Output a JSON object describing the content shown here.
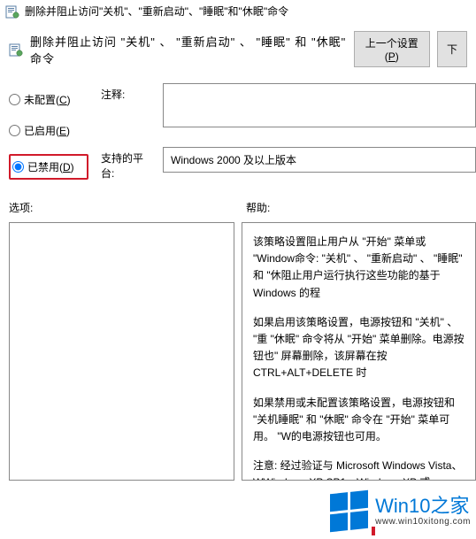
{
  "window": {
    "title": "删除并阻止访问\"关机\"、\"重新启动\"、\"睡眠\"和\"休眠\"命令"
  },
  "header": {
    "policy_title": "删除并阻止访问 \"关机\" 、 \"重新启动\" 、 \"睡眠\" 和 \"休眠\" 命令",
    "prev_btn": "上一个设置(P)",
    "next_btn": "下"
  },
  "radios": {
    "not_configured": "未配置(C)",
    "enabled": "已启用(E)",
    "disabled": "已禁用(D)"
  },
  "fields": {
    "comment_label": "注释:",
    "comment_value": "",
    "platform_label": "支持的平台:",
    "platform_value": "Windows 2000 及以上版本"
  },
  "sections": {
    "options_label": "选项:",
    "help_label": "帮助:"
  },
  "help": {
    "p1": "该策略设置阻止用户从 \"开始\" 菜单或 \"Window命令: \"关机\" 、 \"重新启动\" 、 \"睡眠\" 和 \"休阻止用户运行执行这些功能的基于 Windows 的程",
    "p2": "如果启用该策略设置，电源按钮和 \"关机\" 、 \"重 \"休眠\" 命令将从 \"开始\" 菜单删除。电源按钮也\" 屏幕删除，该屏幕在按 CTRL+ALT+DELETE 时",
    "p3": "如果禁用或未配置该策略设置，电源按钮和 \"关机睡眠\" 和 \"休眠\" 命令在 \"开始\" 菜单可用。 \"W的电源按钮也可用。",
    "p4": "注意: 经过验证与 Microsoft Windows Vista、WWindows XP SP1、Windows XP 或 Windows 容的第三方程序也要求支持该策略设置。"
  },
  "watermark": {
    "brand_en": "Win10",
    "brand_zh": "之家",
    "url": "www.win10xitong.com"
  }
}
